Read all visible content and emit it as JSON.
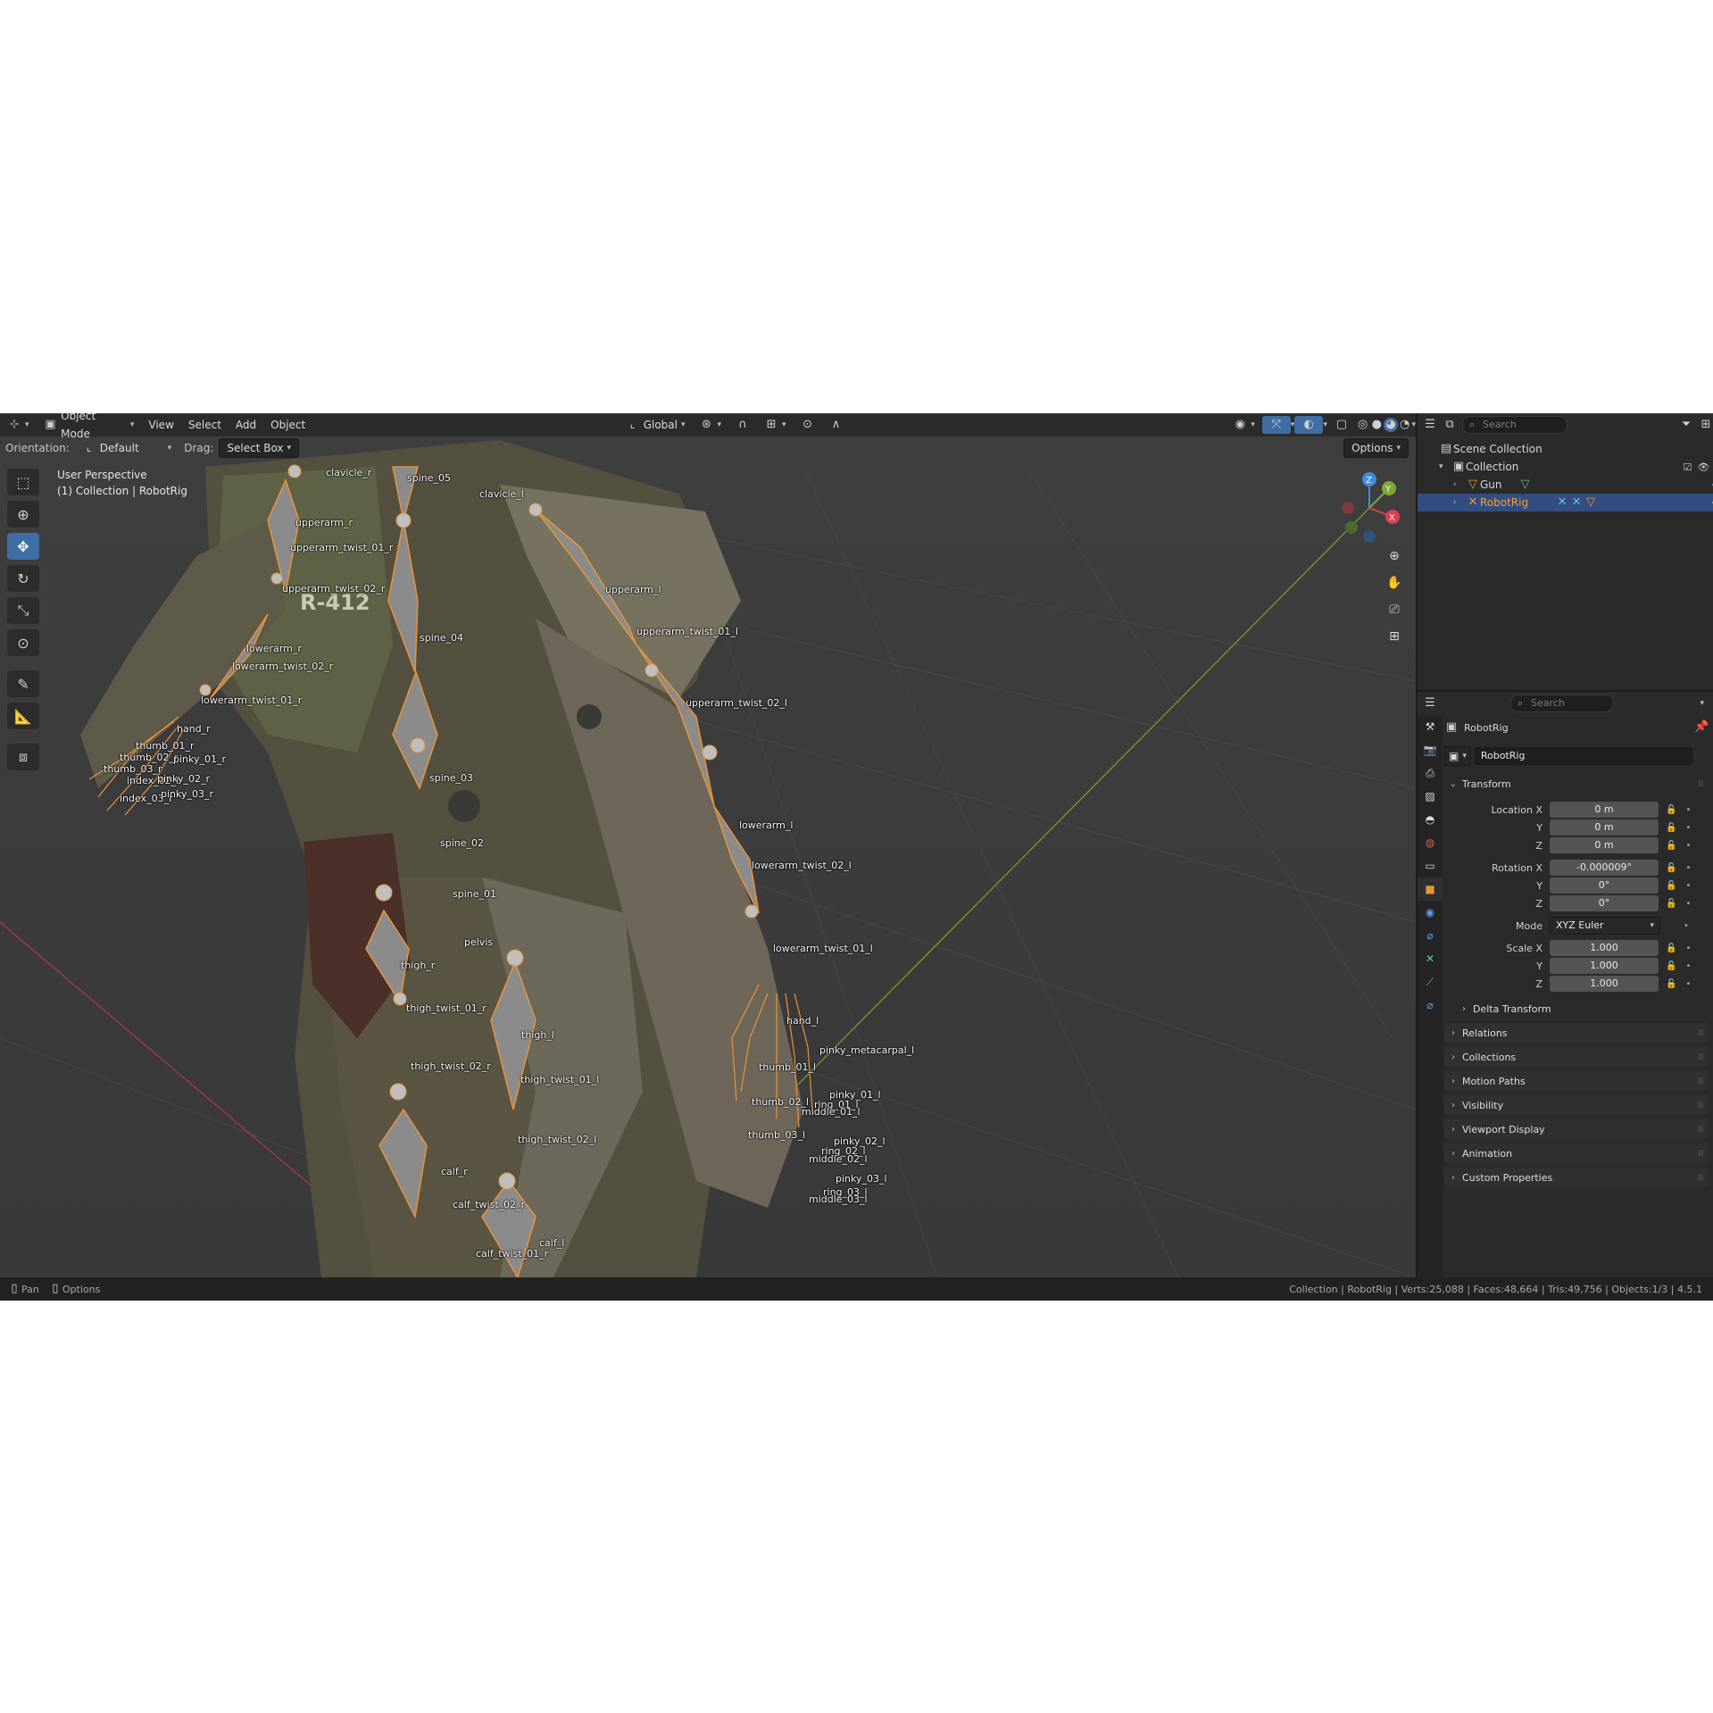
{
  "viewport_header": {
    "mode": "Object Mode",
    "menus": [
      "View",
      "Select",
      "Add",
      "Object"
    ],
    "transform_orientation": "Global"
  },
  "tool_settings": {
    "orientation_label": "Orientation:",
    "orientation_value": "Default",
    "drag_label": "Drag:",
    "drag_value": "Select Box",
    "options": "Options"
  },
  "viewport_info": {
    "perspective": "User Perspective",
    "context": "(1) Collection | RobotRig"
  },
  "gizmo_axes": {
    "z": "Z",
    "y": "Y",
    "x": "X"
  },
  "bone_labels": [
    {
      "name": "clavicle_r"
    },
    {
      "name": "spine_05"
    },
    {
      "name": "clavicle_l"
    },
    {
      "name": "upperarm_r"
    },
    {
      "name": "upperarm_twist_01_r"
    },
    {
      "name": "upperarm_twist_02_r"
    },
    {
      "name": "upperarm_l"
    },
    {
      "name": "upperarm_twist_01_l"
    },
    {
      "name": "upperarm_twist_02_l"
    },
    {
      "name": "spine_04"
    },
    {
      "name": "lowerarm_r"
    },
    {
      "name": "lowerarm_twist_02_r"
    },
    {
      "name": "lowerarm_twist_01_r"
    },
    {
      "name": "hand_r"
    },
    {
      "name": "thumb_01_r"
    },
    {
      "name": "thumb_02_r"
    },
    {
      "name": "thumb_03_r"
    },
    {
      "name": "index_02_r"
    },
    {
      "name": "index_03_r"
    },
    {
      "name": "pinky_01_r"
    },
    {
      "name": "pinky_02_r"
    },
    {
      "name": "pinky_03_r"
    },
    {
      "name": "spine_03"
    },
    {
      "name": "spine_02"
    },
    {
      "name": "spine_01"
    },
    {
      "name": "pelvis"
    },
    {
      "name": "lowerarm_l"
    },
    {
      "name": "lowerarm_twist_02_l"
    },
    {
      "name": "lowerarm_twist_01_l"
    },
    {
      "name": "hand_l"
    },
    {
      "name": "pinky_metacarpal_l"
    },
    {
      "name": "thumb_01_l"
    },
    {
      "name": "thumb_02_l"
    },
    {
      "name": "thumb_03_l"
    },
    {
      "name": "pinky_01_l"
    },
    {
      "name": "ring_01_l"
    },
    {
      "name": "middle_01_l"
    },
    {
      "name": "pinky_02_l"
    },
    {
      "name": "ring_02_l"
    },
    {
      "name": "middle_02_l"
    },
    {
      "name": "pinky_03_l"
    },
    {
      "name": "ring_03_l"
    },
    {
      "name": "middle_03_l"
    },
    {
      "name": "thigh_r"
    },
    {
      "name": "thigh_twist_01_r"
    },
    {
      "name": "thigh_twist_02_r"
    },
    {
      "name": "thigh_l"
    },
    {
      "name": "thigh_twist_01_l"
    },
    {
      "name": "thigh_twist_02_l"
    },
    {
      "name": "calf_r"
    },
    {
      "name": "calf_twist_02_r"
    },
    {
      "name": "calf_twist_01_r"
    },
    {
      "name": "calf_l"
    }
  ],
  "outliner": {
    "search_placeholder": "Search",
    "scene_collection": "Scene Collection",
    "collection": "Collection",
    "items": [
      {
        "name": "Gun"
      },
      {
        "name": "RobotRig"
      }
    ]
  },
  "properties": {
    "search_placeholder": "Search",
    "object_name": "RobotRig",
    "object_field": "RobotRig",
    "transform_title": "Transform",
    "location": {
      "label": "Location X",
      "x": "0 m",
      "y": "0 m",
      "z": "0 m"
    },
    "rotation": {
      "label": "Rotation X",
      "x": "-0.000009°",
      "y": "0°",
      "z": "0°"
    },
    "mode": {
      "label": "Mode",
      "value": "XYZ Euler"
    },
    "scale": {
      "label": "Scale X",
      "x": "1.000",
      "y": "1.000",
      "z": "1.000"
    },
    "axis_y": "Y",
    "axis_z": "Z",
    "delta_transform": "Delta Transform",
    "panels": [
      "Relations",
      "Collections",
      "Motion Paths",
      "Visibility",
      "Viewport Display",
      "Animation",
      "Custom Properties"
    ]
  },
  "status_bar": {
    "pan": "Pan",
    "options": "Options",
    "stats": "Collection | RobotRig | Verts:25,088 | Faces:48,664 | Tris:49,756 | Objects:1/3 | 4.5.1"
  },
  "colors": {
    "accent": "#3f6ea5",
    "selected_row": "#334d80",
    "bone_outline": "#e8943a",
    "x_axis": "#d9404f",
    "y_axis": "#7ea932",
    "z_axis": "#3d8ce0"
  }
}
